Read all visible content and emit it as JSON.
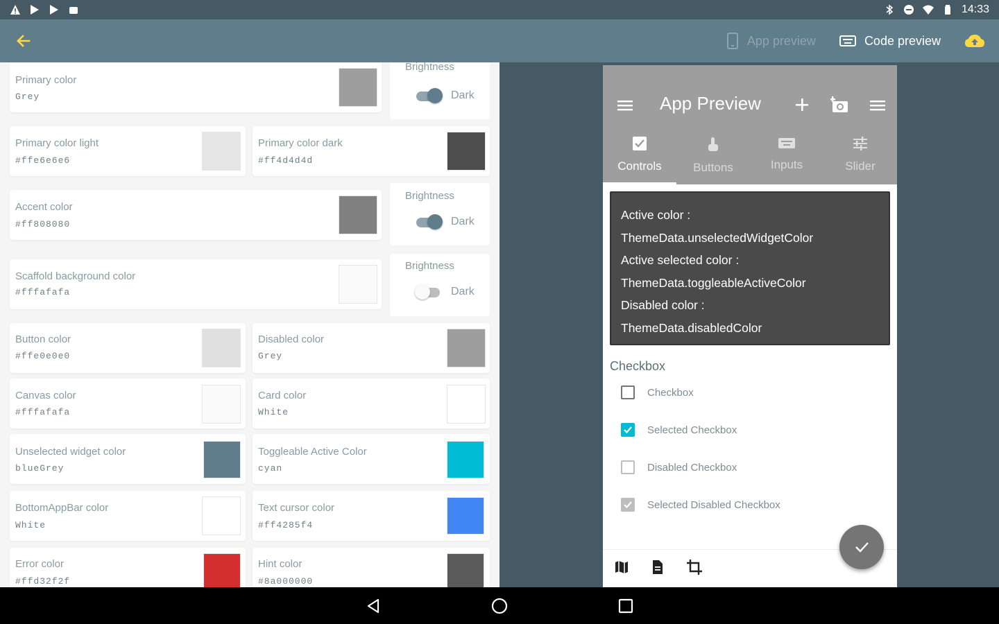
{
  "status_bar": {
    "time": "14:33",
    "left_icons": [
      "warning-icon",
      "play-store-icon",
      "play-store-icon",
      "android-icon"
    ],
    "right_icons": [
      "bluetooth-icon",
      "dnd-icon",
      "wifi-icon",
      "battery-icon"
    ]
  },
  "app_bar": {
    "color": "#607d8b",
    "accent": "#ffd740",
    "app_preview_label": "App preview",
    "code_preview_label": "Code preview"
  },
  "brightness_label": "Brightness",
  "dark_label": "Dark",
  "colors": [
    {
      "label": "Primary color",
      "value": "Grey",
      "hex": "#9e9e9e"
    },
    {
      "label": "Primary color light",
      "value": "#ffe6e6e6",
      "hex": "#e6e6e6"
    },
    {
      "label": "Primary color dark",
      "value": "#ff4d4d4d",
      "hex": "#4d4d4d"
    },
    {
      "label": "Accent color",
      "value": "#ff808080",
      "hex": "#808080"
    },
    {
      "label": "Scaffold background color",
      "value": "#fffafafa",
      "hex": "#fafafa"
    },
    {
      "label": "Button color",
      "value": "#ffe0e0e0",
      "hex": "#e0e0e0"
    },
    {
      "label": "Disabled color",
      "value": "Grey",
      "hex": "#9e9e9e"
    },
    {
      "label": "Canvas color",
      "value": "#fffafafa",
      "hex": "#fafafa"
    },
    {
      "label": "Card color",
      "value": "White",
      "hex": "#ffffff"
    },
    {
      "label": "Unselected widget color",
      "value": "blueGrey",
      "hex": "#607d8b"
    },
    {
      "label": "Toggleable Active Color",
      "value": "cyan",
      "hex": "#00bcd4"
    },
    {
      "label": "BottomAppBar color",
      "value": "White",
      "hex": "#ffffff"
    },
    {
      "label": "Text cursor color",
      "value": "#ff4285f4",
      "hex": "#4285f4"
    },
    {
      "label": "Error color",
      "value": "#ffd32f2f",
      "hex": "#d32f2f"
    },
    {
      "label": "Hint color",
      "value": "#8a000000",
      "hex": "#5a5a5a"
    }
  ],
  "toggles": [
    {
      "on": true
    },
    {
      "on": true
    },
    {
      "on": false
    }
  ],
  "preview": {
    "title": "App Preview",
    "tabs": [
      {
        "label": "Controls",
        "icon": "checkbox-icon",
        "active": true
      },
      {
        "label": "Buttons",
        "icon": "touch-icon",
        "active": false
      },
      {
        "label": "Inputs",
        "icon": "keyboard-icon",
        "active": false
      },
      {
        "label": "Slider",
        "icon": "tune-icon",
        "active": false
      }
    ],
    "info_lines": [
      "Active color :",
      "ThemeData.unselectedWidgetColor",
      "Active selected color :",
      "ThemeData.toggleableActiveColor",
      "Disabled color :",
      "ThemeData.disabledColor"
    ],
    "section_title": "Checkbox",
    "checkboxes": [
      {
        "label": "Checkbox",
        "state": "unchecked"
      },
      {
        "label": "Selected Checkbox",
        "state": "checked"
      },
      {
        "label": "Disabled Checkbox",
        "state": "disabled"
      },
      {
        "label": "Selected Disabled Checkbox",
        "state": "disabled-checked"
      }
    ]
  }
}
